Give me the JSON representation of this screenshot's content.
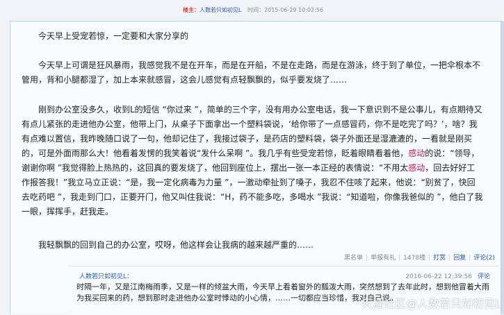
{
  "post": {
    "owner_label": "楼主：",
    "author": "人数若只如初见L",
    "time_label": "时间：",
    "time": "2015-06-29 10:02:56",
    "paragraphs": [
      "今天早上受宠若惊，一定要和大家分享的",
      "今天早上可谓是狂风暴雨，我感觉我不是在开车，而是在开船，不是在走路，而是在游泳，终于到了单位，一把伞根本不管用，背和小腿都湿了，加上本来就感冒，这会儿感觉有点轻飘飘的，似乎要发烧了……",
      "刚到办公室没多久，收到L的短信 “你过来 ”，简单的三个字，没有用办公室电话，我一下意识到不是公事儿，有点期待又有点儿紧张的走进他办公室，他带上门，从桌子下面拿出一个塑料袋说，‘给你带了一点感冒药，你不是吃完了吗？’，啥？我有点难以置信，我昨晚随口说了一句，他却记住了，我接过袋子，是药店的塑料袋，袋子外面还是湿漉漉的，一看就是刚买的，可是外面雨那么大！他看着发愣的我笑着说“发什么呆啊 ”。我几乎有些受宠若惊，眨着眼睛看着他，",
      "的说：“领导，谢谢你啊 ”我觉得脸上热热的，这回真的要发烧了，他回到座位上，摆出一张一本正经的表情说：“不用太",
      "，回去好好工作报答我！”我立马立正说：“是，我一定化病毒为力量 ”，一激动牵扯到了嗓子，我忍不住咳了起来，他说：“别贫了，快回去吃药吧 ”，我走到门口，正要开门，他又叫住我说：“H，药不能多吃，多喝水 ”我说：“知道啦，你像我爸似的 ”，他白了我一眼，挥挥手，赶我走。",
      "我轻飘飘的回到自己的办公室，哎呀，他这样会让我病的越来越严重的……"
    ],
    "highlight_word": "感动"
  },
  "actions": {
    "blacklist": "黑名单",
    "report": "举报有礼",
    "floor": "1478楼",
    "tip": "打赏",
    "reply": "回复",
    "comment": "评论(2)"
  },
  "comment": {
    "author": "人数若只如初见L：",
    "time": "2016-06-22 12:39:56",
    "reply": "评论",
    "text": "时隔一年，又是江南梅雨季，又是一样的倾盆大雨，今天早上看着窗外的瓢泼大雨，突然想到了去年此时，想到他冒着大雨为我买回来的药，想到那时走进他办公室时悸动的小心情，……一切都应当珍惜，我对自己说。"
  },
  "watermark": "天涯社区@人数若只如初见L"
}
